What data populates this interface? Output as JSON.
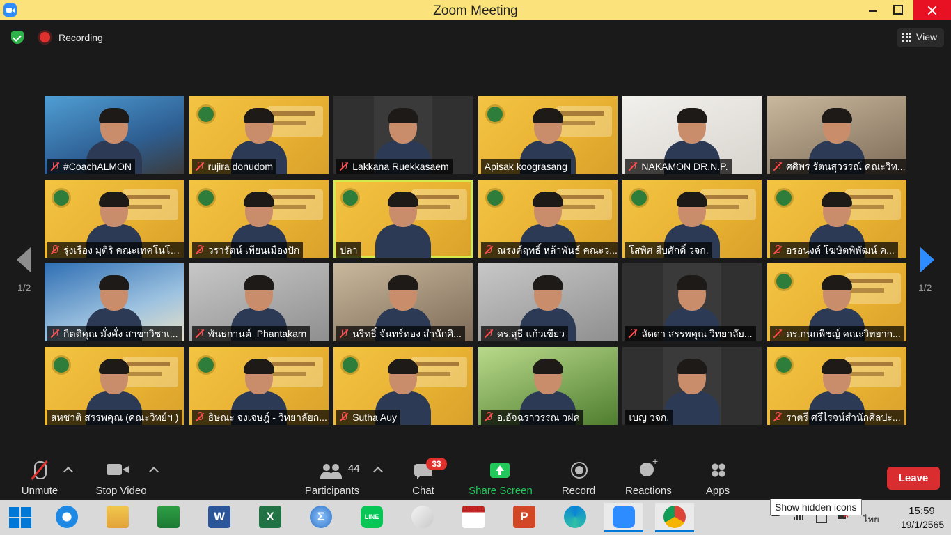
{
  "window": {
    "title": "Zoom Meeting"
  },
  "top": {
    "recording_label": "Recording",
    "view_label": "View"
  },
  "nav": {
    "page_indicator": "1/2"
  },
  "tiles": [
    {
      "name": "#CoachALMON",
      "muted": true,
      "bg": "coach"
    },
    {
      "name": "rujira donudom",
      "muted": true,
      "bg": "yellow"
    },
    {
      "name": "Lakkana Ruekkasaem",
      "muted": true,
      "bg": "dark"
    },
    {
      "name": "Apisak koograsang",
      "muted": false,
      "bg": "yellow"
    },
    {
      "name": "NAKAMON DR.N.P.",
      "muted": true,
      "bg": "white"
    },
    {
      "name": "ศศิพร รัตนสุวรรณ์ คณะวิท...",
      "muted": true,
      "bg": "room"
    },
    {
      "name": "รุ่งเรือง มุติริ คณะเทคโนโลย...",
      "muted": true,
      "bg": "yellow"
    },
    {
      "name": "วรารัตน์ เทียนเมืองปัก",
      "muted": true,
      "bg": "yellow"
    },
    {
      "name": "ปลา",
      "muted": false,
      "bg": "yellow",
      "active": true
    },
    {
      "name": "ณรงค์ฤทธิ์ หล้าพันธ์ คณะว...",
      "muted": true,
      "bg": "yellow"
    },
    {
      "name": "โสพิศ สืบศักดิ์ วจก.",
      "muted": false,
      "bg": "yellow"
    },
    {
      "name": "อรอนงค์ โฆษิตพิพัฒน์ ค...",
      "muted": true,
      "bg": "yellow"
    },
    {
      "name": "กิตติคุณ มั่งคั่ง สาขาวิชาเ...",
      "muted": true,
      "bg": "blue"
    },
    {
      "name": "พันธกานต์_Phantakarn",
      "muted": true,
      "bg": "gray"
    },
    {
      "name": "นริทธิ์ จันทร์ทอง สำนักศิ...",
      "muted": true,
      "bg": "room"
    },
    {
      "name": "ดร.สุธี แก้วเขียว",
      "muted": true,
      "bg": "gray"
    },
    {
      "name": "ลัดดา สรรพคุณ วิทยาลัย...",
      "muted": true,
      "bg": "dark"
    },
    {
      "name": "ดร.กนกพิชญ์ คณะวิทยาก...",
      "muted": true,
      "bg": "yellow"
    },
    {
      "name": "สหชาติ สรรพคุณ (คณะวิทย์ฯ )",
      "muted": false,
      "bg": "yellow"
    },
    {
      "name": "ธิษณะ จงเจษฎ์ - วิทยาลัยก...",
      "muted": true,
      "bg": "yellow"
    },
    {
      "name": "Sutha Auy",
      "muted": true,
      "bg": "yellow"
    },
    {
      "name": "อ.อัจฉราวรรณ วฝค",
      "muted": true,
      "bg": "green"
    },
    {
      "name": "เบญ วจก.",
      "muted": false,
      "bg": "dark"
    },
    {
      "name": "ราตรี ศรีไรจน์สำนักศิลปะ...",
      "muted": true,
      "bg": "yellow"
    }
  ],
  "toolbar": {
    "unmute": "Unmute",
    "stop_video": "Stop Video",
    "participants": "Participants",
    "participants_count": "44",
    "chat": "Chat",
    "chat_badge": "33",
    "share_screen": "Share Screen",
    "record": "Record",
    "reactions": "Reactions",
    "apps": "Apps",
    "leave": "Leave"
  },
  "taskbar": {
    "apps": [
      {
        "name": "internet-explorer",
        "letter": "e"
      },
      {
        "name": "file-explorer",
        "letter": ""
      },
      {
        "name": "microsoft-store",
        "letter": ""
      },
      {
        "name": "word",
        "letter": "W"
      },
      {
        "name": "excel",
        "letter": "X"
      },
      {
        "name": "calculator",
        "letter": "Σ"
      },
      {
        "name": "line",
        "letter": "LINE"
      },
      {
        "name": "paint",
        "letter": ""
      },
      {
        "name": "lisrel",
        "letter": "LISREL"
      },
      {
        "name": "powerpoint",
        "letter": "P"
      },
      {
        "name": "edge",
        "letter": ""
      },
      {
        "name": "zoom",
        "letter": ""
      },
      {
        "name": "chrome",
        "letter": ""
      }
    ],
    "tooltip": "Show hidden icons",
    "language": "ไทย",
    "time": "15:59",
    "date": "19/1/2565"
  },
  "colors": {
    "accent": "#2d8cff",
    "share_green": "#23c85a",
    "leave_red": "#d92d2f",
    "titlebar": "#fbe27a"
  }
}
